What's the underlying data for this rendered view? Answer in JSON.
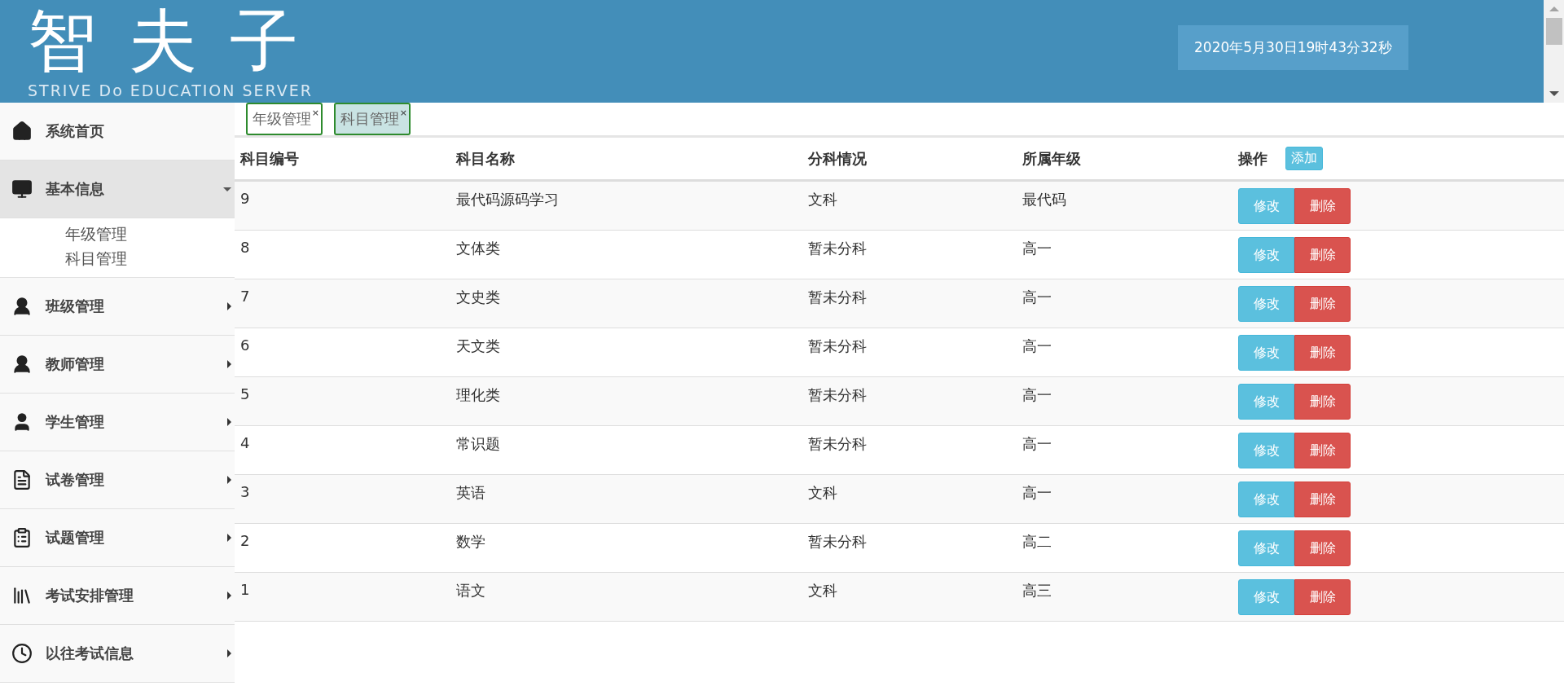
{
  "header": {
    "logo": "智夫子",
    "subtitle": "STRIVE Do EDUCATION SERVER",
    "datetime": "2020年5月30日19时43分32秒"
  },
  "sidebar": {
    "items": [
      {
        "label": "系统首页"
      },
      {
        "label": "基本信息",
        "expanded": true,
        "children": [
          {
            "label": "年级管理"
          },
          {
            "label": "科目管理"
          }
        ]
      },
      {
        "label": "班级管理",
        "expanded": false
      },
      {
        "label": "教师管理",
        "expanded": false
      },
      {
        "label": "学生管理",
        "expanded": false
      },
      {
        "label": "试卷管理",
        "expanded": false
      },
      {
        "label": "试题管理",
        "expanded": false
      },
      {
        "label": "考试安排管理",
        "expanded": false
      },
      {
        "label": "以往考试信息",
        "expanded": false
      }
    ]
  },
  "tabs": [
    {
      "label": "年级管理",
      "close": "×",
      "selected": false
    },
    {
      "label": "科目管理",
      "close": "×",
      "selected": true
    }
  ],
  "table": {
    "columns": [
      "科目编号",
      "科目名称",
      "分科情况",
      "所属年级",
      "操作"
    ],
    "add_button": "添加",
    "rows": [
      {
        "id": "9",
        "name": "最代码源码学习",
        "category": "文科",
        "grade": "最代码",
        "actions": [
          "修改",
          "删除"
        ]
      },
      {
        "id": "8",
        "name": "文体类",
        "category": "暂未分科",
        "grade": "高一",
        "actions": [
          "修改",
          "删除"
        ]
      },
      {
        "id": "7",
        "name": "文史类",
        "category": "暂未分科",
        "grade": "高一",
        "actions": [
          "修改",
          "删除"
        ]
      },
      {
        "id": "6",
        "name": "天文类",
        "category": "暂未分科",
        "grade": "高一",
        "actions": [
          "修改",
          "删除"
        ]
      },
      {
        "id": "5",
        "name": "理化类",
        "category": "暂未分科",
        "grade": "高一",
        "actions": [
          "修改",
          "删除"
        ]
      },
      {
        "id": "4",
        "name": "常识题",
        "category": "暂未分科",
        "grade": "高一",
        "actions": [
          "修改",
          "删除"
        ]
      },
      {
        "id": "3",
        "name": "英语",
        "category": "文科",
        "grade": "高一",
        "actions": [
          "修改",
          "删除"
        ]
      },
      {
        "id": "2",
        "name": "数学",
        "category": "暂未分科",
        "grade": "高二",
        "actions": [
          "修改",
          "删除"
        ]
      },
      {
        "id": "1",
        "name": "语文",
        "category": "文科",
        "grade": "高三",
        "actions": [
          "修改",
          "删除"
        ]
      }
    ]
  }
}
